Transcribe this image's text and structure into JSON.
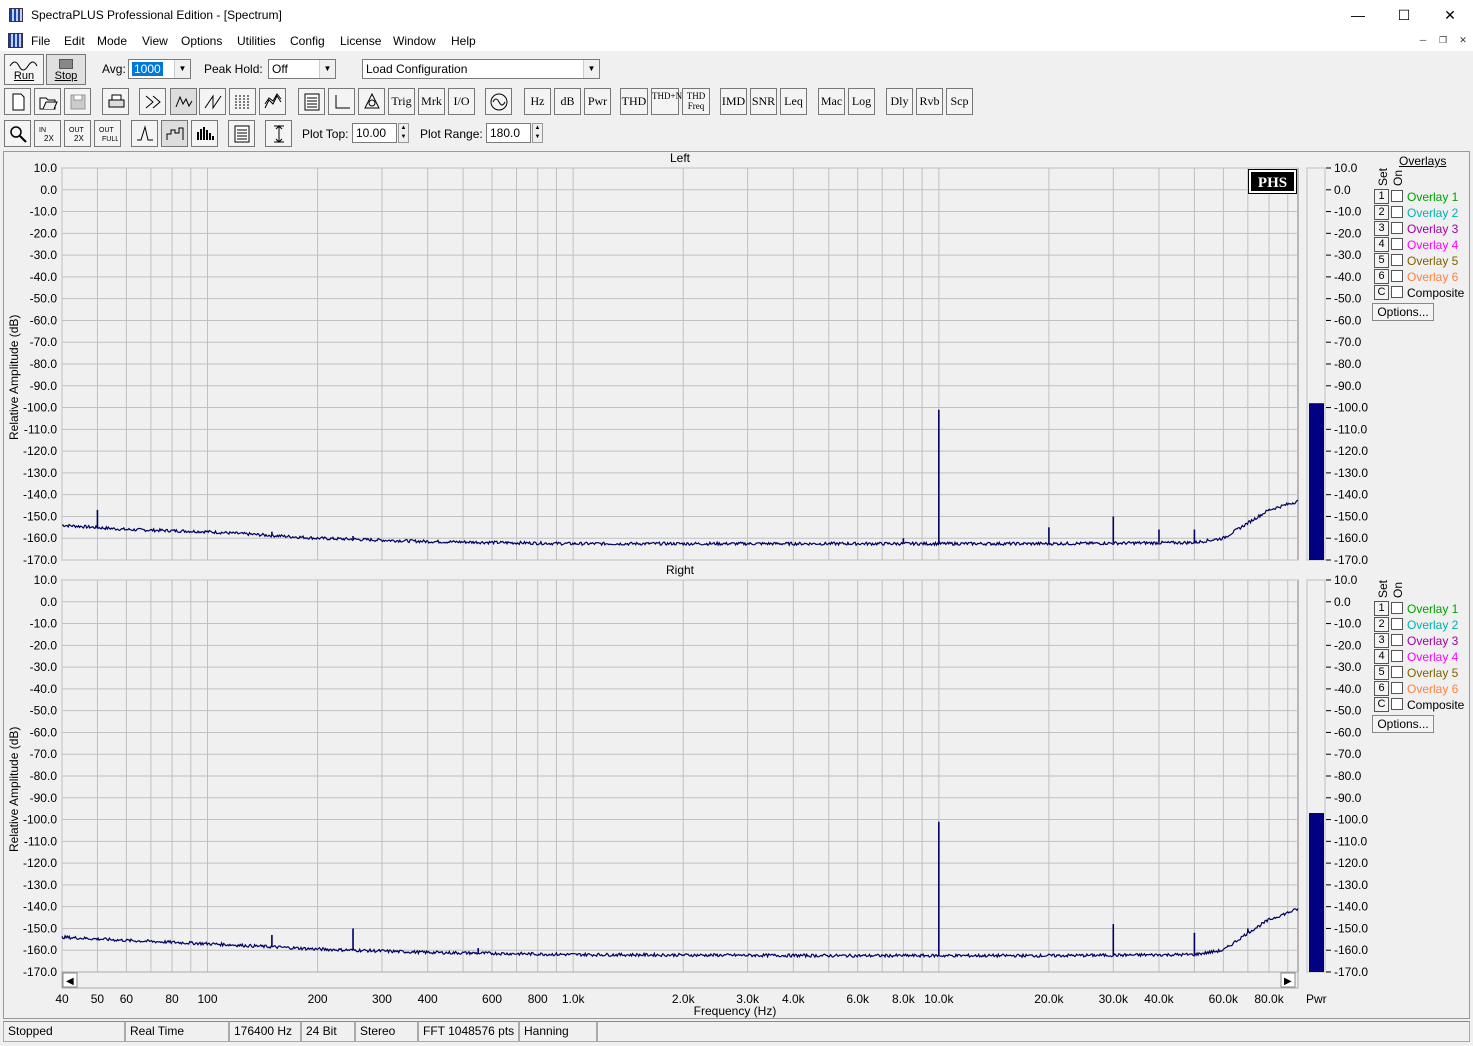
{
  "window": {
    "title": "SpectraPLUS Professional Edition - [Spectrum]"
  },
  "menu": [
    "File",
    "Edit",
    "Mode",
    "View",
    "Options",
    "Utilities",
    "Config",
    "License",
    "Window",
    "Help"
  ],
  "controls": {
    "run_label": "Run",
    "stop_label": "Stop",
    "avg_label": "Avg:",
    "avg_value": "1000",
    "peak_hold_label": "Peak Hold:",
    "peak_hold_value": "Off",
    "config_value": "Load Configuration",
    "plot_top_label": "Plot Top:",
    "plot_top_value": "10.00",
    "plot_range_label": "Plot Range:",
    "plot_range_value": "180.0"
  },
  "toolbar_text_buttons": [
    "Trig",
    "Mrk",
    "I/O",
    "Hz",
    "dB",
    "Pwr",
    "THD",
    "THD+N",
    "THD Freq",
    "IMD",
    "SNR",
    "Leq",
    "Mac",
    "Log",
    "Dly",
    "Rvb",
    "Scp"
  ],
  "panels": [
    {
      "title": "Left",
      "logo": "PHS",
      "bar_level_db": -98
    },
    {
      "title": "Right",
      "bar_level_db": -97
    }
  ],
  "y_label": "Relative Amplitude (dB)",
  "x_label": "Frequency (Hz)",
  "y_ticks": [
    "10.0",
    "0.0",
    "-10.0",
    "-20.0",
    "-30.0",
    "-40.0",
    "-50.0",
    "-60.0",
    "-70.0",
    "-80.0",
    "-90.0",
    "-100.0",
    "-110.0",
    "-120.0",
    "-130.0",
    "-140.0",
    "-150.0",
    "-160.0",
    "-170.0"
  ],
  "x_ticks": [
    "40",
    "50",
    "60",
    "80",
    "100",
    "200",
    "300",
    "400",
    "600",
    "800",
    "1.0k",
    "2.0k",
    "3.0k",
    "4.0k",
    "6.0k",
    "8.0k",
    "10.0k",
    "20.0k",
    "30.0k",
    "40.0k",
    "60.0k",
    "80.0k"
  ],
  "pwr_label": "Pwr",
  "overlays": {
    "header": "Overlays",
    "col_set": "Set",
    "col_on": "On",
    "items": [
      {
        "num": "1",
        "label": "Overlay 1",
        "color": "#00a000"
      },
      {
        "num": "2",
        "label": "Overlay 2",
        "color": "#00b0b0"
      },
      {
        "num": "3",
        "label": "Overlay 3",
        "color": "#a000a0"
      },
      {
        "num": "4",
        "label": "Overlay 4",
        "color": "#ff00ff"
      },
      {
        "num": "5",
        "label": "Overlay 5",
        "color": "#806000"
      },
      {
        "num": "6",
        "label": "Overlay 6",
        "color": "#ff8040"
      },
      {
        "num": "C",
        "label": "Composite",
        "color": "#000000"
      }
    ],
    "options_label": "Options..."
  },
  "chart_data": [
    {
      "type": "line",
      "title": "Left",
      "xlabel": "Frequency (Hz)",
      "ylabel": "Relative Amplitude (dB)",
      "xscale": "log",
      "xlim": [
        40,
        96000
      ],
      "ylim": [
        -170,
        10
      ],
      "noise_floor": [
        [
          40,
          -154
        ],
        [
          60,
          -156
        ],
        [
          100,
          -157
        ],
        [
          200,
          -160
        ],
        [
          400,
          -161.5
        ],
        [
          1000,
          -162.5
        ],
        [
          5000,
          -162.5
        ],
        [
          20000,
          -162.5
        ],
        [
          50000,
          -162
        ],
        [
          60000,
          -160
        ],
        [
          70000,
          -153
        ],
        [
          80000,
          -147
        ],
        [
          96000,
          -143
        ]
      ],
      "peaks": [
        [
          50,
          -147
        ],
        [
          150,
          -157
        ],
        [
          250,
          -159
        ],
        [
          8000,
          -160
        ],
        [
          10000,
          -101
        ],
        [
          20000,
          -155
        ],
        [
          30000,
          -150
        ],
        [
          40000,
          -156
        ],
        [
          50000,
          -156
        ],
        [
          60000,
          -160
        ]
      ]
    },
    {
      "type": "line",
      "title": "Right",
      "xlabel": "Frequency (Hz)",
      "ylabel": "Relative Amplitude (dB)",
      "xscale": "log",
      "xlim": [
        40,
        96000
      ],
      "ylim": [
        -170,
        10
      ],
      "noise_floor": [
        [
          40,
          -154
        ],
        [
          60,
          -155.5
        ],
        [
          100,
          -157
        ],
        [
          200,
          -159.5
        ],
        [
          400,
          -161
        ],
        [
          1000,
          -162
        ],
        [
          5000,
          -162.5
        ],
        [
          20000,
          -162.5
        ],
        [
          50000,
          -162
        ],
        [
          60000,
          -160
        ],
        [
          70000,
          -152
        ],
        [
          80000,
          -146
        ],
        [
          96000,
          -141
        ]
      ],
      "peaks": [
        [
          150,
          -153
        ],
        [
          250,
          -150
        ],
        [
          550,
          -159
        ],
        [
          10000,
          -101
        ],
        [
          30000,
          -148
        ],
        [
          50000,
          -152
        ],
        [
          70000,
          -150
        ]
      ]
    }
  ],
  "status": [
    "Stopped",
    "Real Time",
    "176400 Hz",
    "24 Bit",
    "Stereo",
    "FFT 1048576 pts",
    "Hanning"
  ],
  "colors": {
    "trace": "#000060",
    "grid": "#c0c0c0",
    "plot_bg": "#f0f0f0",
    "bar": "#000080"
  }
}
